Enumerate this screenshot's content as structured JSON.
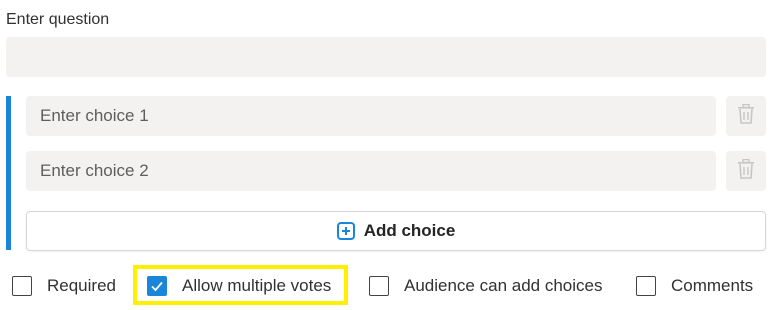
{
  "question": {
    "label": "Enter question",
    "value": ""
  },
  "choices": [
    {
      "placeholder": "Enter choice 1",
      "value": ""
    },
    {
      "placeholder": "Enter choice 2",
      "value": ""
    }
  ],
  "add_choice": {
    "label": "Add choice",
    "icon": "plus-square-icon"
  },
  "options": [
    {
      "label": "Required",
      "checked": false
    },
    {
      "label": "Allow multiple votes",
      "checked": true,
      "highlighted": true
    },
    {
      "label": "Audience can add choices",
      "checked": false
    },
    {
      "label": "Comments",
      "checked": false
    }
  ],
  "colors": {
    "accent": "#1a86d9",
    "field_background": "#f3f2f1",
    "highlight": "#ffef00"
  }
}
